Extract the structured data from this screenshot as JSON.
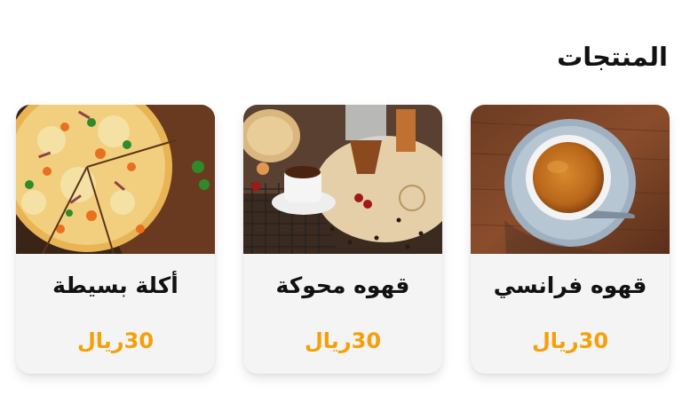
{
  "section": {
    "title": "المنتجات"
  },
  "colors": {
    "price": "#f5a00a",
    "card_bg": "#f4f4f4",
    "title": "#111111"
  },
  "products": [
    {
      "name": "قهوه فرانسي",
      "price": "30ريال",
      "image_icon": "french-coffee-cup-photo"
    },
    {
      "name": "قهوه محوكة",
      "price": "30ريال",
      "image_icon": "spiced-coffee-table-photo"
    },
    {
      "name": "أكلة بسيطة",
      "price": "30ريال",
      "image_icon": "pizza-photo"
    }
  ]
}
